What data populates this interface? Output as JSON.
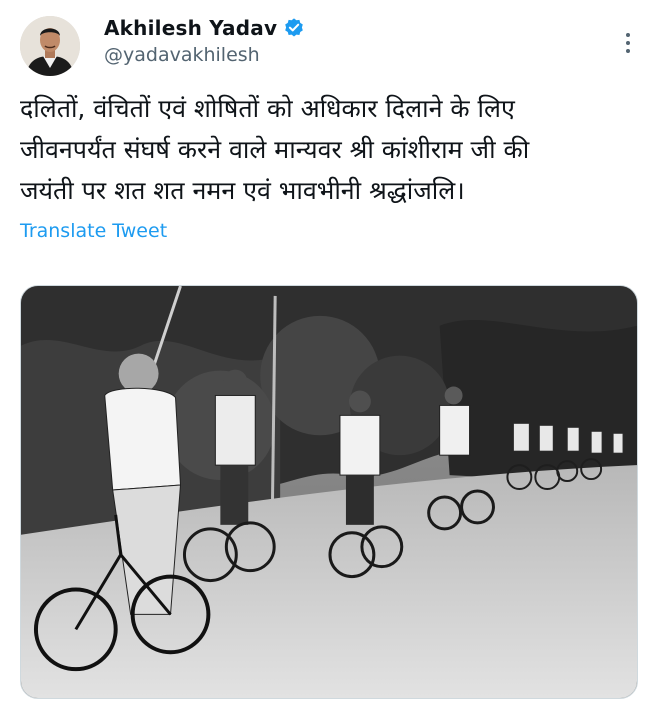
{
  "author": {
    "display_name": "Akhilesh Yadav",
    "handle": "@yadavakhilesh",
    "verified": true,
    "verified_color": "#1d9bf0"
  },
  "icons": {
    "verified": "verified-badge-icon",
    "more": "more-options-icon"
  },
  "tweet": {
    "text": "दलितों, वंचितों एवं शोषितों को अधिकार दिलाने के लिए\nजीवनपर्यंत संघर्ष करने वाले मान्यवर श्री कांशीराम जी की\nजयंती पर शत शत नमन एवं भावभीनी श्रद्धांजलि।",
    "translate_label": "Translate Tweet",
    "link_color": "#1d9bf0"
  },
  "media": {
    "kind": "black-and-white photo"
  }
}
